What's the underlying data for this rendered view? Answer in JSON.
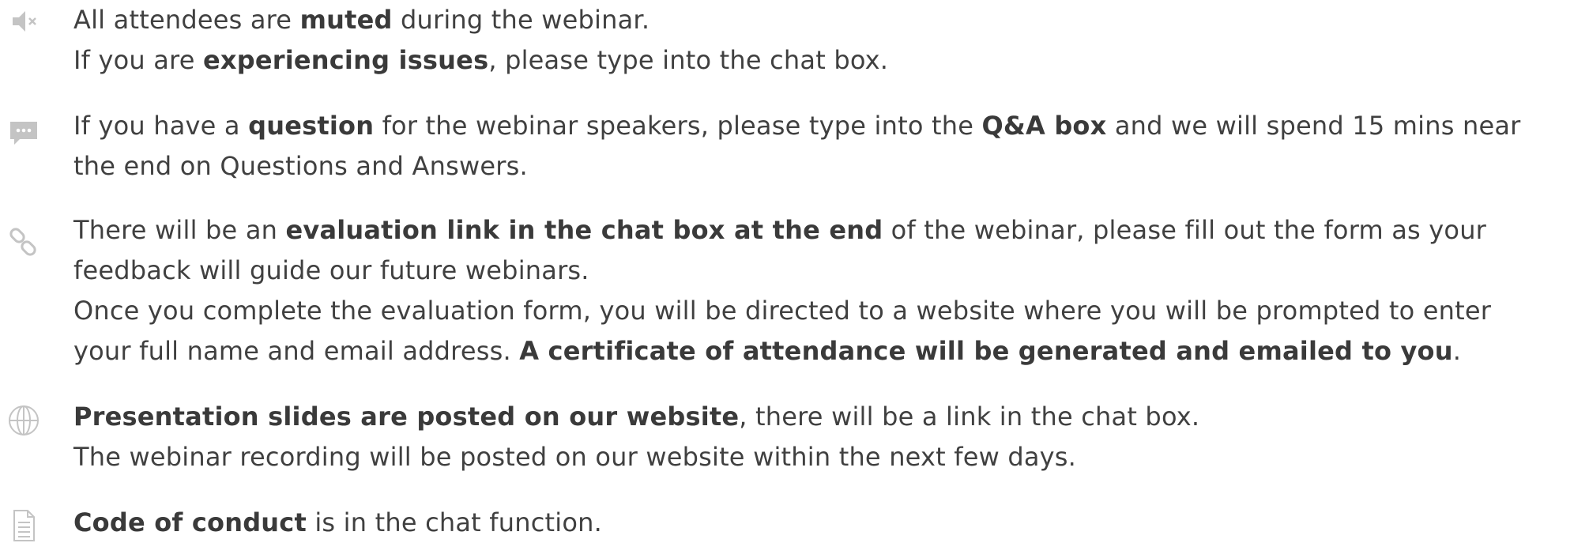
{
  "icons": {
    "muted": "speaker-muted-icon",
    "question": "chat-bubble-icon",
    "evaluation": "link-chain-icon",
    "slides": "globe-icon",
    "conduct": "document-icon"
  },
  "colors": {
    "text": "#404040",
    "icon": "#bfbfbf"
  },
  "notices": {
    "muted": {
      "l1_a": "All attendees are ",
      "l1_b": "muted",
      "l1_c": " during the webinar.",
      "l2_a": "If you are ",
      "l2_b": "experiencing issues",
      "l2_c": ", please type into the chat box."
    },
    "question": {
      "l1_a": "If you have a ",
      "l1_b": "question",
      "l1_c": " for the webinar speakers, please type into the ",
      "l1_d": "Q&A box",
      "l1_e": " and we will spend 15 mins near",
      "l2": "the end on Questions and Answers."
    },
    "evaluation": {
      "l1_a": "There will be an ",
      "l1_b": "evaluation link in the chat box at the end",
      "l1_c": " of the webinar, please fill out the form as your",
      "l2": "feedback will guide our future webinars.",
      "l3": "Once you complete the evaluation form, you will be directed to a website where you will be prompted to enter",
      "l4_a": "your full name and email address. ",
      "l4_b": "A certificate of attendance will be generated and emailed to you",
      "l4_c": "."
    },
    "slides": {
      "l1_a": "Presentation slides are posted on our website",
      "l1_b": ", there will be a link in the chat box.",
      "l2": "The webinar recording will be posted on our website within the next few days."
    },
    "conduct": {
      "l1_a": "Code of conduct",
      "l1_b": " is in the chat function."
    }
  }
}
